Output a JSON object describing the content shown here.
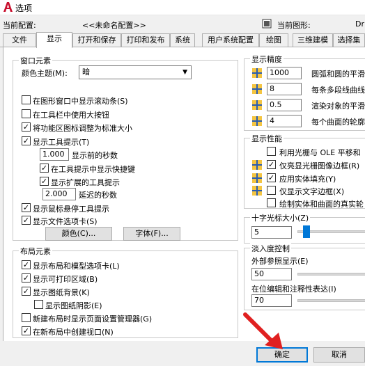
{
  "window": {
    "title": "选项"
  },
  "config": {
    "current_config_label": "当前配置:",
    "current_config_value": "<<未命名配置>>",
    "current_drawing_label": "当前图形:",
    "current_drawing_value": "Dr"
  },
  "tabs": [
    "文件",
    "显示",
    "打开和保存",
    "打印和发布",
    "系统",
    "用户系统配置",
    "绘图",
    "三维建模",
    "选择集"
  ],
  "window_elements": {
    "title": "窗口元素",
    "color_theme_label": "颜色主题(M):",
    "color_theme_value": "暗",
    "items": [
      "在图形窗口中显示滚动条(S)",
      "在工具栏中使用大按钮",
      "将功能区图标调整为标准大小",
      "显示工具提示(T)",
      "显示前的秒数",
      "在工具提示中显示快捷键",
      "显示扩展的工具提示",
      "延迟的秒数",
      "显示鼠标悬停工具提示",
      "显示文件选项卡(S)"
    ],
    "seconds_before": "1.000",
    "delay_seconds": "2.000",
    "colors_button": "颜色(C)...",
    "fonts_button": "字体(F)..."
  },
  "layout_elements": {
    "title": "布局元素",
    "items": [
      "显示布局和模型选项卡(L)",
      "显示可打印区域(B)",
      "显示图纸背景(K)",
      "显示图纸阴影(E)",
      "新建布局时显示页面设置管理器(G)",
      "在新布局中创建视口(N)"
    ]
  },
  "display_resolution": {
    "title": "显示精度",
    "rows": [
      {
        "value": "1000",
        "label": "圆弧和圆的平滑"
      },
      {
        "value": "8",
        "label": "每条多段线曲线"
      },
      {
        "value": "0.5",
        "label": "渲染对象的平滑"
      },
      {
        "value": "4",
        "label": "每个曲面的轮廓"
      }
    ]
  },
  "display_performance": {
    "title": "显示性能",
    "items": [
      "利用光栅与 OLE 平移和",
      "仅亮显光栅图像边框(R)",
      "应用实体填充(Y)",
      "仅显示文字边框(X)",
      "绘制实体和曲面的真实轮"
    ]
  },
  "crosshair": {
    "title": "十字光标大小(Z)",
    "value": "5"
  },
  "fade_control": {
    "title": "淡入度控制",
    "xref_label": "外部参照显示(E)",
    "xref_value": "50",
    "inplace_label": "在位编辑和注释性表达(I)",
    "inplace_value": "70"
  },
  "footer": {
    "ok": "确定",
    "cancel": "取消"
  },
  "colors": {
    "accent": "#0078d7",
    "annotation_arrow": "#e02020"
  }
}
